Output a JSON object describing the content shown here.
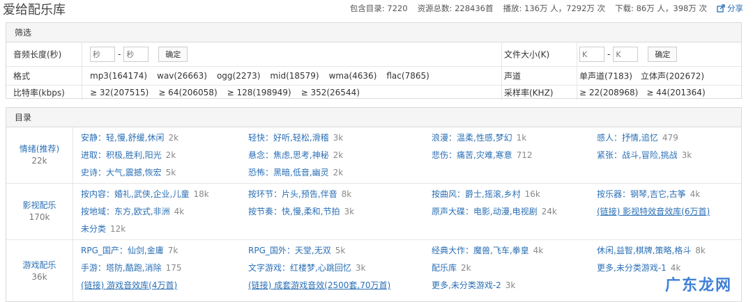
{
  "header": {
    "title": "爱给配乐库",
    "stats": {
      "catalog": "包含目录: 7220",
      "total": "资源总数: 228436首",
      "plays": "播放: 136万 人，7292万 次",
      "downloads": "下载: 86万 人，398万 次"
    },
    "share_label": "分享"
  },
  "filter": {
    "heading": "筛选",
    "duration_label": "音频长度(秒)",
    "duration_min_placeholder": "秒",
    "duration_max_placeholder": "秒",
    "range_sep": "-",
    "ok_label": "确定",
    "filesize_label": "文件大小(K)",
    "filesize_min_placeholder": "K",
    "filesize_max_placeholder": "K",
    "format_label": "格式",
    "formats": [
      "mp3(164174)",
      "wav(26663)",
      "ogg(2273)",
      "mid(18579)",
      "wma(4636)",
      "flac(7865)"
    ],
    "channel_label": "声道",
    "channels": [
      "单声道(7183)",
      "立体声(202672)"
    ],
    "bitrate_label": "比特率(kbps)",
    "bitrates": [
      "≥ 32(207515)",
      "≥ 64(206058)",
      "≥ 128(198949)",
      "≥ 352(26544)"
    ],
    "samplerate_label": "采样率(KHZ)",
    "samplerates": [
      "≥ 22(208968)",
      "≥ 44(201364)"
    ]
  },
  "catalog": {
    "heading": "目录",
    "groups": [
      {
        "title": "情绪(推荐)",
        "count": "22k",
        "items": [
          {
            "t": "安静：轻,慢,舒缓,休闲",
            "c": "2k"
          },
          {
            "t": "轻快：好听,轻松,滑稽",
            "c": "3k"
          },
          {
            "t": "浪漫：温柔,性感,梦幻",
            "c": "1k"
          },
          {
            "t": "感人：抒情,追忆",
            "c": "479"
          },
          {
            "t": "进取：积极,胜利,阳光",
            "c": "2k"
          },
          {
            "t": "悬念：焦虑,思考,神秘",
            "c": "2k"
          },
          {
            "t": "悲伤：痛苦,灾难,寒意",
            "c": "712"
          },
          {
            "t": "紧张：战斗,冒险,挑战",
            "c": "3k"
          },
          {
            "t": "史诗：大气,震撼,恢宏",
            "c": "5k"
          },
          {
            "t": "恐怖：黑暗,低音,幽灵",
            "c": "2k"
          }
        ]
      },
      {
        "title": "影视配乐",
        "count": "170k",
        "items": [
          {
            "t": "按内容：婚礼,武侠,企业,儿童",
            "c": "18k"
          },
          {
            "t": "按环节：片头,预告,伴音",
            "c": "8k"
          },
          {
            "t": "按曲风：爵士,摇滚,乡村",
            "c": "16k"
          },
          {
            "t": "按乐器：钢琴,吉它,古筝",
            "c": "4k"
          },
          {
            "t": "按地域：东方,欧式,非洲",
            "c": "4k"
          },
          {
            "t": "按节奏：快,慢,柔和,节拍",
            "c": "3k"
          },
          {
            "t": "原声大碟：电影,动漫,电视剧",
            "c": "24k"
          },
          {
            "t": "(链接) 影视特效音效库(6万首)",
            "c": "",
            "link": true
          },
          {
            "t": "未分类",
            "c": "12k"
          }
        ]
      },
      {
        "title": "游戏配乐",
        "count": "36k",
        "items": [
          {
            "t": "RPG_国产：仙剑,金庸",
            "c": "7k"
          },
          {
            "t": "RPG_国外：天堂,无双",
            "c": "5k"
          },
          {
            "t": "经典大作：魔兽,飞车,拳皇",
            "c": "4k"
          },
          {
            "t": "休闲,益智,棋牌,策略,格斗",
            "c": "8k"
          },
          {
            "t": "手游：塔防,酷跑,消除",
            "c": "175"
          },
          {
            "t": "文字游戏：红楼梦,心跳回忆",
            "c": "3k"
          },
          {
            "t": "配乐库",
            "c": "2k"
          },
          {
            "t": "更多,未分类游戏-1",
            "c": "4k"
          },
          {
            "t": "(链接) 游戏音效库(4万首)",
            "c": "",
            "link": true
          },
          {
            "t": "(链接) 成套游戏音效(2500套,70万首)",
            "c": "",
            "link": true
          },
          {
            "t": "更多,未分类游戏-2",
            "c": "3k"
          }
        ]
      }
    ]
  },
  "watermark": "广东龙网",
  "colors": {
    "link": "#2a6fb5",
    "border": "#d9d9d9",
    "header_bg": "#f5f5f5"
  }
}
